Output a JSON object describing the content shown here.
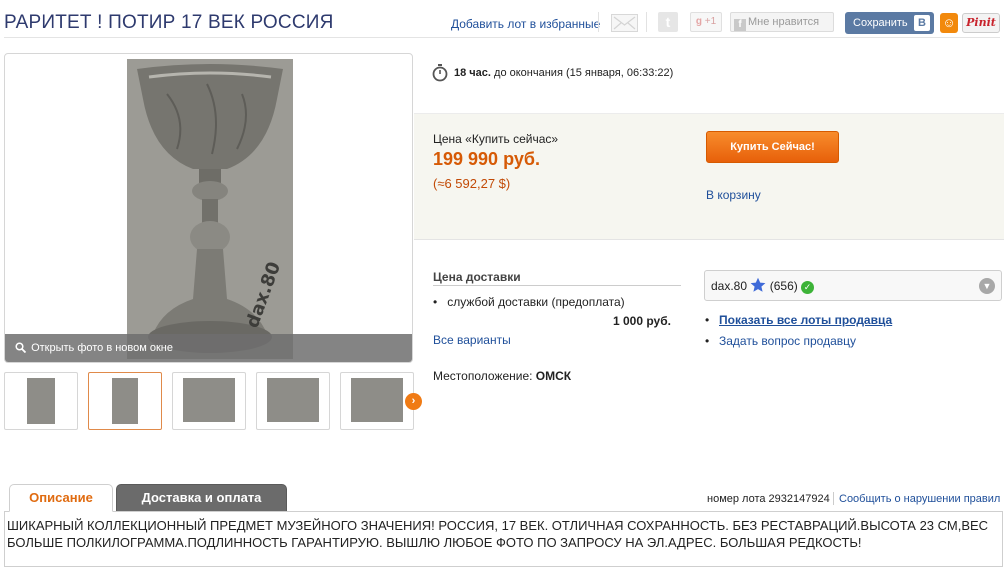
{
  "header": {
    "title": "РАРИТЕТ ! ПОТИР 17 ВЕК РОССИЯ",
    "favorite_link": "Добавить лот в избранные",
    "gplus_label": "+1",
    "like_label": "Мне нравится",
    "save_label": "Сохранить",
    "vk_letter": "B",
    "pin_label": "Pinit"
  },
  "gallery": {
    "open_photo_label": "Открыть фото в новом окне",
    "watermark": "dax.80",
    "thumbnail_count": 5,
    "active_thumbnail_index": 1
  },
  "timer": {
    "hours": "18 час.",
    "rest": " до окончания (15 января, 06:33:22)"
  },
  "buy": {
    "price_label": "Цена «Купить сейчас»",
    "price": "199 990 руб.",
    "price_usd": "(≈6 592,27 $)",
    "buy_button": "Купить Сейчас!",
    "cart_link": "В корзину"
  },
  "shipping": {
    "title": "Цена доставки",
    "method": "службой доставки (предоплата)",
    "price": "1 000 руб.",
    "all_options": "Все варианты",
    "location_label": "Местоположение: ",
    "location_value": "ОМСК"
  },
  "seller": {
    "name": "dax.80",
    "rating": "(656)",
    "show_all_lots": "Показать все лоты продавца",
    "ask_question": "Задать вопрос продавцу"
  },
  "tabs": {
    "description": "Описание",
    "delivery": "Доставка и оплата"
  },
  "lot": {
    "number": "номер лота 2932147924",
    "report": "Сообщить о нарушении правил"
  },
  "description": {
    "text": "ШИКАРНЫЙ КОЛЛЕКЦИОННЫЙ ПРЕДМЕТ МУЗЕЙНОГО ЗНАЧЕНИЯ! РОССИЯ, 17 ВЕК. ОТЛИЧНАЯ СОХРАННОСТЬ. БЕЗ РЕСТАВРАЦИЙ.ВЫСОТА 23 СМ,ВЕС БОЛЬШЕ ПОЛКИЛОГРАММА.ПОДЛИННОСТЬ ГАРАНТИРУЮ. ВЫШЛЮ ЛЮБОЕ ФОТО ПО ЗАПРОСУ НА ЭЛ.АДРЕС. БОЛЬШАЯ РЕДКОСТЬ!"
  },
  "colors": {
    "accent_orange": "#e7600a",
    "price_orange": "#d65a06",
    "link_blue": "#1f4f9a",
    "title_blue": "#2e3a6e"
  }
}
